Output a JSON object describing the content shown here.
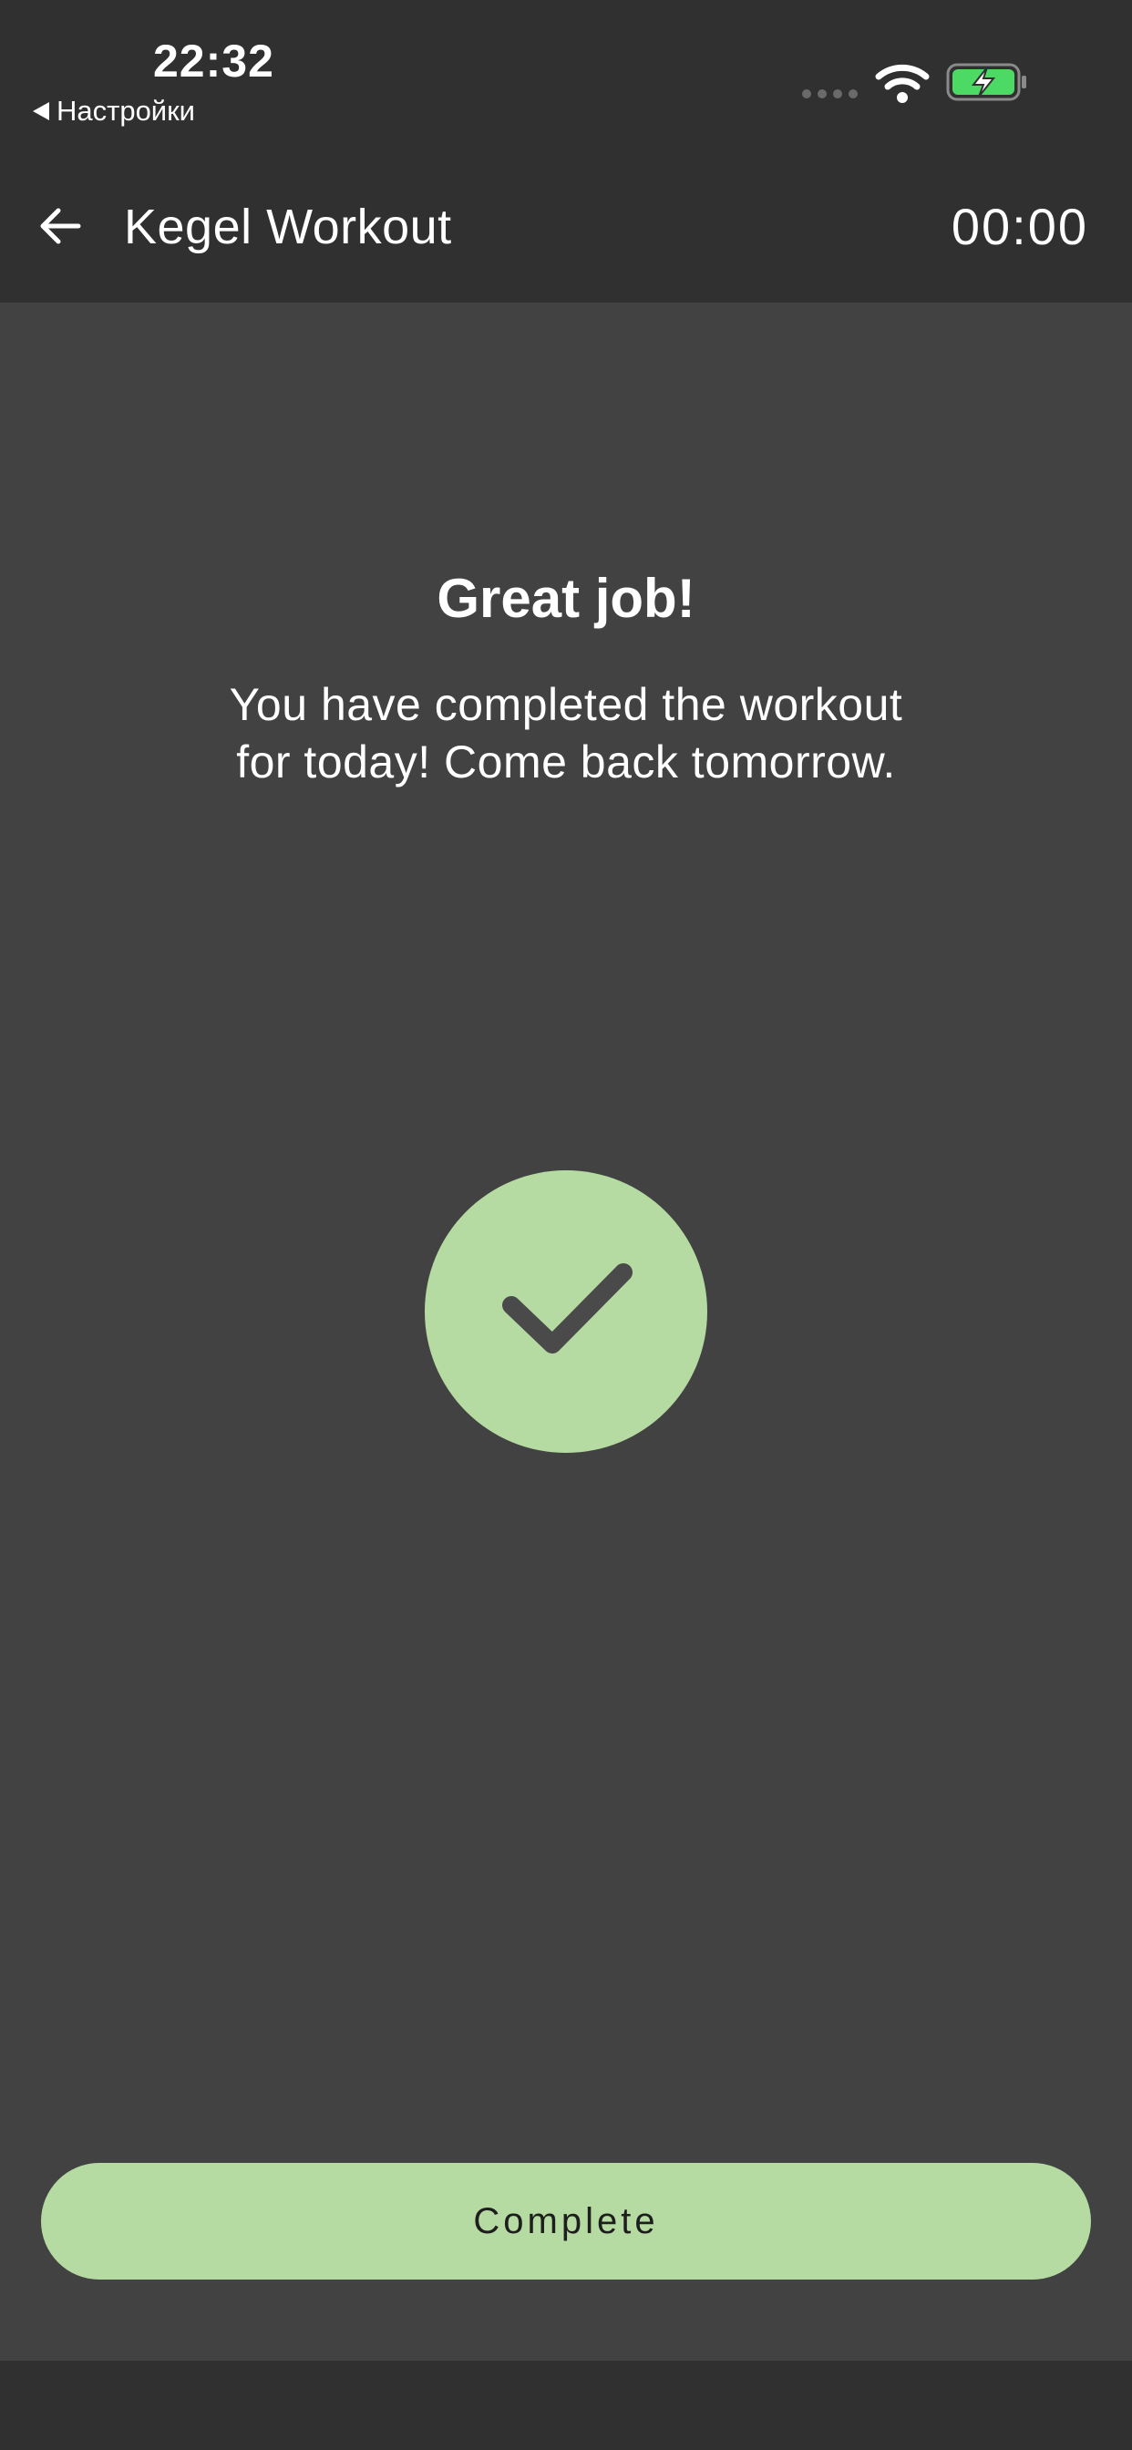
{
  "status_bar": {
    "time": "22:32",
    "back_label": "Настройки"
  },
  "app_bar": {
    "title": "Kegel Workout",
    "timer": "00:00"
  },
  "main": {
    "title": "Great job!",
    "message": "You have completed the workout for today! Come back tomorrow."
  },
  "complete_button": {
    "label": "Complete"
  },
  "colors": {
    "accent": "#b6dba2",
    "background": "#424242",
    "bar": "#303030",
    "battery_fill": "#4cd964"
  },
  "icons": {
    "back": "arrow-left-icon",
    "check": "check-icon",
    "wifi": "wifi-icon",
    "battery": "battery-charging-icon",
    "signal": "signal-dots-icon"
  }
}
